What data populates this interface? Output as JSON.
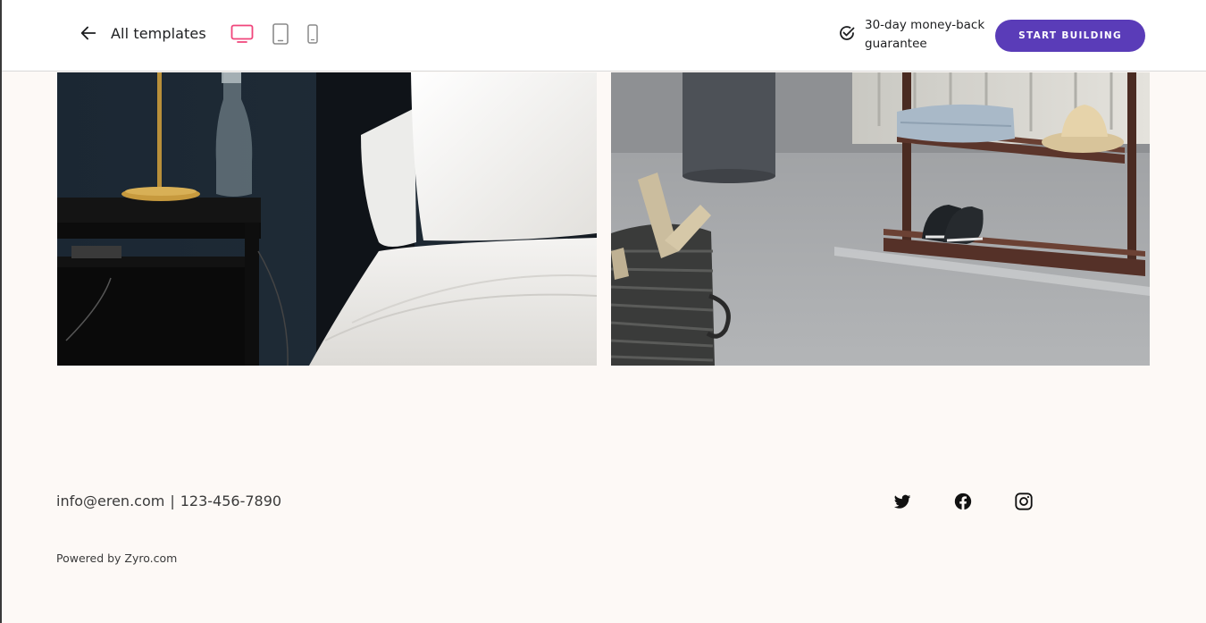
{
  "header": {
    "back_label": "All templates",
    "devices": [
      {
        "name": "desktop",
        "active": true
      },
      {
        "name": "tablet",
        "active": false
      },
      {
        "name": "mobile",
        "active": false
      }
    ],
    "guarantee_text": "30-day money-back guarantee",
    "cta_label": "START BUILDING"
  },
  "colors": {
    "accent": "#5a3cb8",
    "active_device": "#f0457b",
    "inactive_device": "#8a8a8a",
    "page_background": "#fdf9f6"
  },
  "gallery": {
    "images": [
      {
        "name": "bedroom-photo",
        "description_icon": "image"
      },
      {
        "name": "shoe-rack-photo",
        "description_icon": "image"
      }
    ]
  },
  "footer": {
    "email": "info@eren.com",
    "separator": "|",
    "phone": "123-456-7890",
    "powered_by": "Powered by Zyro.com",
    "social": [
      "twitter-icon",
      "facebook-icon",
      "instagram-icon"
    ]
  }
}
